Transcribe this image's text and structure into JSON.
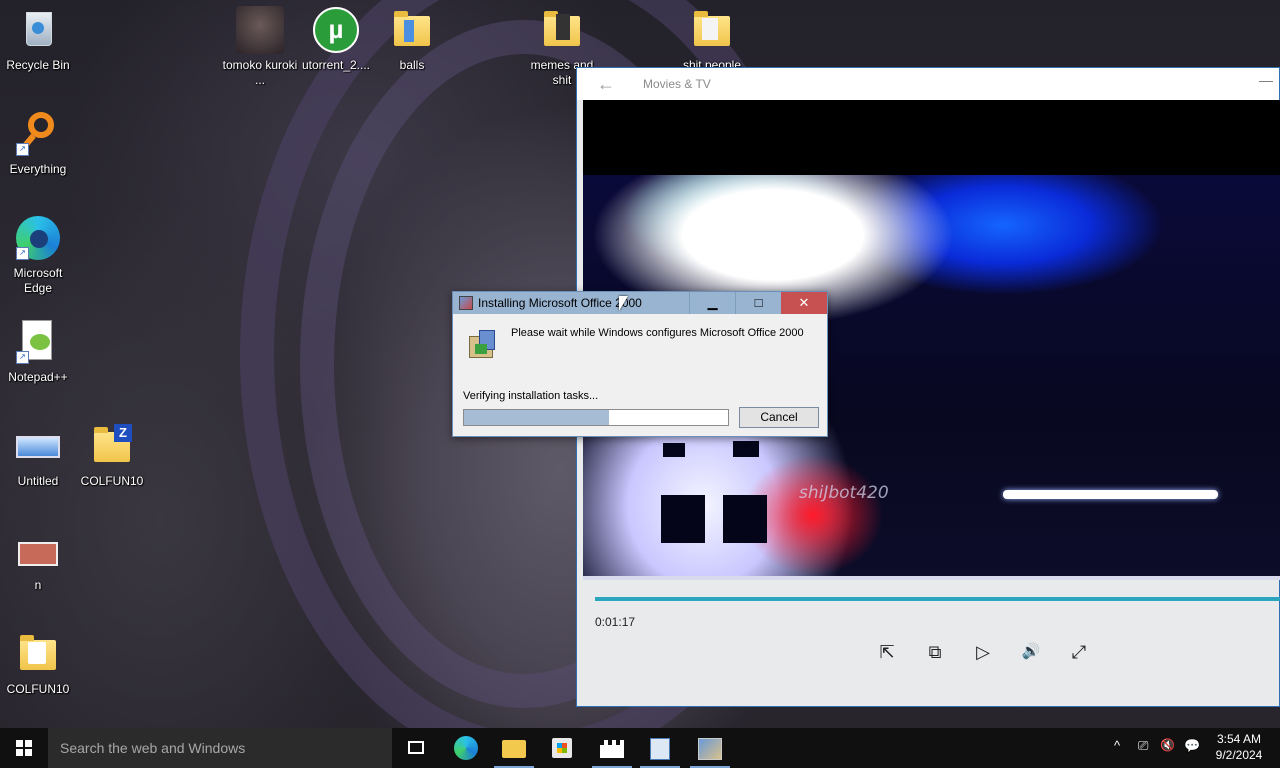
{
  "desktop": {
    "icons": [
      {
        "label": "Recycle Bin",
        "icon": "recycle-bin-icon"
      },
      {
        "label": "tomoko kuroki ...",
        "icon": "image-thumbnail-icon"
      },
      {
        "label": "utorrent_2....",
        "icon": "utorrent-icon"
      },
      {
        "label": "balls",
        "icon": "folder-icon"
      },
      {
        "label": "memes and shit",
        "icon": "folder-icon"
      },
      {
        "label": "shit people",
        "icon": "folder-icon"
      },
      {
        "label": "Everything",
        "icon": "everything-search-icon"
      },
      {
        "label": "Microsoft Edge",
        "icon": "edge-icon"
      },
      {
        "label": "Notepad++",
        "icon": "notepadpp-icon"
      },
      {
        "label": "Untitled",
        "icon": "monitor-icon"
      },
      {
        "label": "COLFUN10",
        "icon": "zip-folder-icon"
      },
      {
        "label": "n",
        "icon": "computer-icon"
      },
      {
        "label": "COLFUN10",
        "icon": "document-folder-icon"
      }
    ]
  },
  "movies_window": {
    "title": "Movies & TV",
    "back_icon": "back-arrow-icon",
    "time": "0:01:17",
    "watermark": "shiJbot420",
    "controls": [
      {
        "name": "cast-icon",
        "glyph": "⇱"
      },
      {
        "name": "mini-view-icon",
        "glyph": "⧉"
      },
      {
        "name": "play-icon",
        "glyph": "▷"
      },
      {
        "name": "volume-icon",
        "glyph": "🔊"
      },
      {
        "name": "fullscreen-icon",
        "glyph": "⤢"
      }
    ]
  },
  "installer": {
    "title": "Installing Microsoft Office 2000",
    "message": "Please wait while Windows configures Microsoft Office 2000",
    "status": "Verifying installation tasks...",
    "progress": 0.55,
    "cancel_label": "Cancel",
    "buttons": {
      "min": "▁",
      "max": "□",
      "close": "✕"
    }
  },
  "taskbar": {
    "search_placeholder": "Search the web and Windows",
    "apps": [
      "task-view-icon",
      "edge-icon",
      "file-explorer-icon",
      "store-icon",
      "movies-tv-icon",
      "calculator-icon",
      "installer-icon"
    ],
    "tray": [
      "^",
      "⎚",
      "🔇",
      "💬"
    ],
    "time": "3:54 AM",
    "date": "9/2/2024"
  },
  "colors": {
    "accent": "#2aa7bf",
    "dialog_title": "#99b4d1",
    "close_red": "#c75050"
  }
}
